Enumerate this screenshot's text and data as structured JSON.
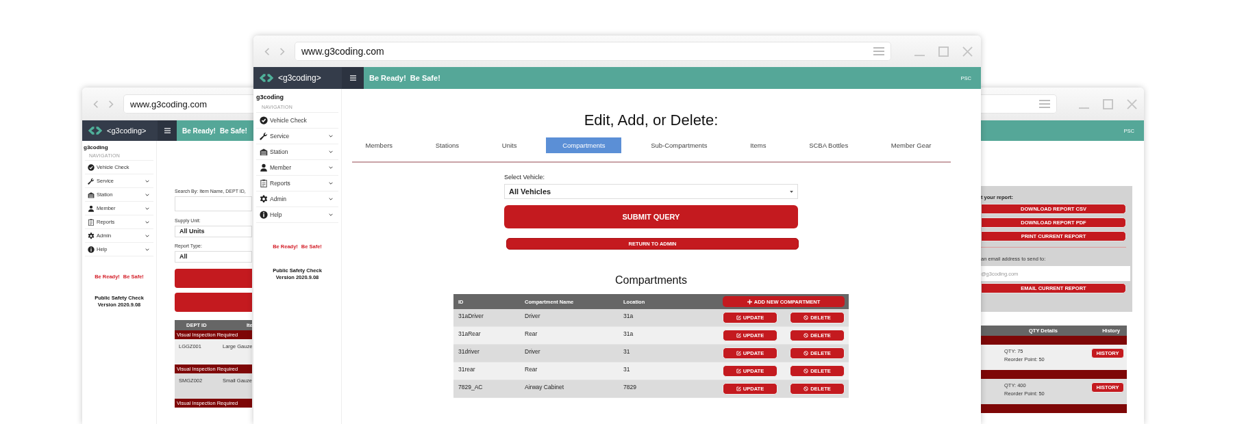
{
  "back_window": {
    "url": "www.g3coding.com",
    "logo_text": "<g3coding>",
    "header_slogan": [
      "Be Ready!",
      "Be Safe!"
    ],
    "header_right": "PSC",
    "sidebar": {
      "brand": "g3coding",
      "section": "NAVIGATION",
      "items": [
        {
          "label": "Vehicle Check",
          "expandable": false
        },
        {
          "label": "Service",
          "expandable": true
        },
        {
          "label": "Station",
          "expandable": true
        },
        {
          "label": "Member",
          "expandable": true
        },
        {
          "label": "Reports",
          "expandable": true
        },
        {
          "label": "Admin",
          "expandable": true
        },
        {
          "label": "Help",
          "expandable": true
        }
      ],
      "slogan": [
        "Be Ready!",
        "Be Safe!"
      ],
      "footer": [
        "Public Safety Check",
        "Version 2020.9.08"
      ]
    },
    "search_form": {
      "search_label": "Search By: Item Name, DEPT ID,",
      "supply_label": "Supply Unit:",
      "supply_value": "All Units",
      "report_label": "Report Type:",
      "report_value": "All"
    },
    "inventory_table": {
      "columns": [
        "DEPT ID",
        "Ite"
      ],
      "groups": [
        {
          "band": "Visual Inspection Required",
          "id": "LGGZ001",
          "name": "Large Gauze"
        },
        {
          "band": "Visual Inspection Required",
          "id": "SMGZ002",
          "name": "Small Gauze"
        },
        {
          "band": "Visual Inspection Required"
        }
      ]
    },
    "export_panel": {
      "title": "t your report:",
      "buttons": [
        "DOWNLOAD REPORT CSV",
        "DOWNLOAD REPORT PDF",
        "PRINT CURRENT REPORT"
      ],
      "email_label": "an email address to send to:",
      "email_placeholder": "@g3coding.com",
      "email_button": "EMAIL CURRENT REPORT"
    },
    "qty_table": {
      "columns": [
        "QTY Details",
        "History"
      ],
      "rows": [
        {
          "qty": "QTY: 75",
          "reorder": "Reorder Point: 50",
          "button": "HISTORY"
        },
        {
          "qty": "QTY: 400",
          "reorder": "Reorder Point: 50",
          "button": "HISTORY"
        }
      ]
    }
  },
  "main_window": {
    "url": "www.g3coding.com",
    "logo_text": "<g3coding>",
    "header_slogan": [
      "Be Ready!",
      "Be Safe!"
    ],
    "header_right": "PSC",
    "sidebar": {
      "brand": "g3coding",
      "section": "NAVIGATION",
      "items": [
        {
          "label": "Vehicle Check",
          "expandable": false
        },
        {
          "label": "Service",
          "expandable": true
        },
        {
          "label": "Station",
          "expandable": true
        },
        {
          "label": "Member",
          "expandable": true
        },
        {
          "label": "Reports",
          "expandable": true
        },
        {
          "label": "Admin",
          "expandable": true
        },
        {
          "label": "Help",
          "expandable": true
        }
      ],
      "slogan": [
        "Be Ready!",
        "Be Safe!"
      ],
      "footer": [
        "Public Safety Check",
        "Version 2020.9.08"
      ]
    },
    "page_title": "Edit, Add, or Delete:",
    "tabs": [
      {
        "label": "Members",
        "selected": false
      },
      {
        "label": "Stations",
        "selected": false
      },
      {
        "label": "Units",
        "selected": false
      },
      {
        "label": "Compartments",
        "selected": true
      },
      {
        "label": "Sub-Compartments",
        "selected": false
      },
      {
        "label": "Items",
        "selected": false
      },
      {
        "label": "SCBA Bottles",
        "selected": false
      },
      {
        "label": "Member Gear",
        "selected": false
      }
    ],
    "vehicle_label": "Select Vehicle:",
    "vehicle_value": "All Vehicles",
    "submit_button": "SUBMIT QUERY",
    "return_button": "RETURN TO ADMIN",
    "table_title": "Compartments",
    "table": {
      "columns": [
        "ID",
        "Compartment Name",
        "Location"
      ],
      "add_button": "ADD NEW COMPARTMENT",
      "rows": [
        {
          "id": "31aDriver",
          "name": "Driver",
          "location": "31a",
          "update": "UPDATE",
          "delete": "DELETE"
        },
        {
          "id": "31aRear",
          "name": "Rear",
          "location": "31a",
          "update": "UPDATE",
          "delete": "DELETE"
        },
        {
          "id": "31driver",
          "name": "Driver",
          "location": "31",
          "update": "UPDATE",
          "delete": "DELETE"
        },
        {
          "id": "31rear",
          "name": "Rear",
          "location": "31",
          "update": "UPDATE",
          "delete": "DELETE"
        },
        {
          "id": "7829_AC",
          "name": "Airway Cabinet",
          "location": "7829",
          "update": "UPDATE",
          "delete": "DELETE"
        }
      ]
    }
  }
}
